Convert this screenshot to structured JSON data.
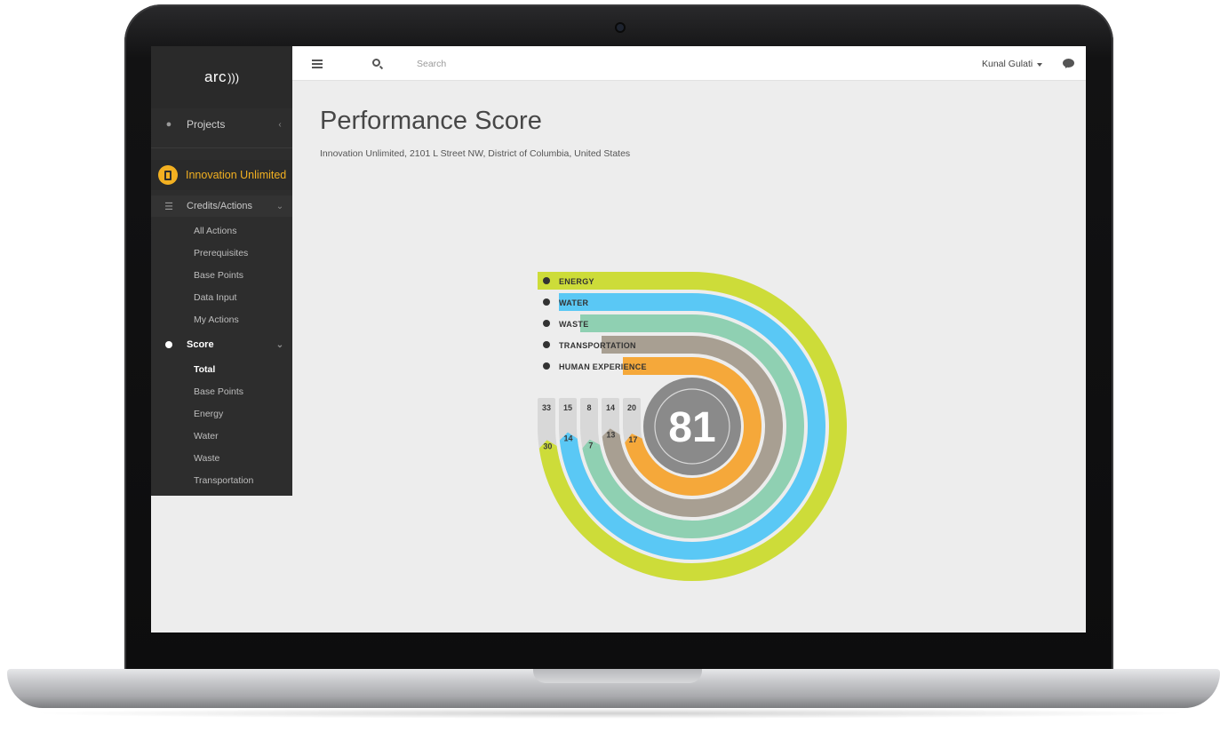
{
  "app": {
    "logo_text": "arc",
    "logo_waves": ")))"
  },
  "sidebar": {
    "projects_label": "Projects",
    "project_name": "Innovation Unlimited",
    "credits_label": "Credits/Actions",
    "credits_items": [
      "All Actions",
      "Prerequisites",
      "Base Points",
      "Data Input",
      "My Actions"
    ],
    "score_label": "Score",
    "score_items": [
      "Total",
      "Base Points",
      "Energy",
      "Water",
      "Waste",
      "Transportation"
    ],
    "active_item": "Total"
  },
  "topbar": {
    "search_placeholder": "Search",
    "user_name": "Kunal Gulati"
  },
  "page": {
    "title": "Performance Score",
    "subtitle": "Innovation Unlimited, 2101 L Street NW, District of Columbia, United States"
  },
  "colors": {
    "energy": "#cddc39",
    "water": "#5ac8f5",
    "waste": "#8fd0b2",
    "transportation": "#a89f92",
    "human_experience": "#f5a83a",
    "track": "#d8d8d8",
    "center": "#8a8a8a",
    "accent": "#f2b021"
  },
  "chart_data": {
    "type": "radial-bar",
    "total_score": 81,
    "categories": [
      "ENERGY",
      "WATER",
      "WASTE",
      "TRANSPORTATION",
      "HUMAN EXPERIENCE"
    ],
    "icons": [
      "lightning-icon",
      "water-drop-icon",
      "recycle-icon",
      "car-icon",
      "person-icon"
    ],
    "max_points": [
      33,
      15,
      8,
      14,
      20
    ],
    "values": [
      30,
      14,
      7,
      13,
      17
    ]
  }
}
